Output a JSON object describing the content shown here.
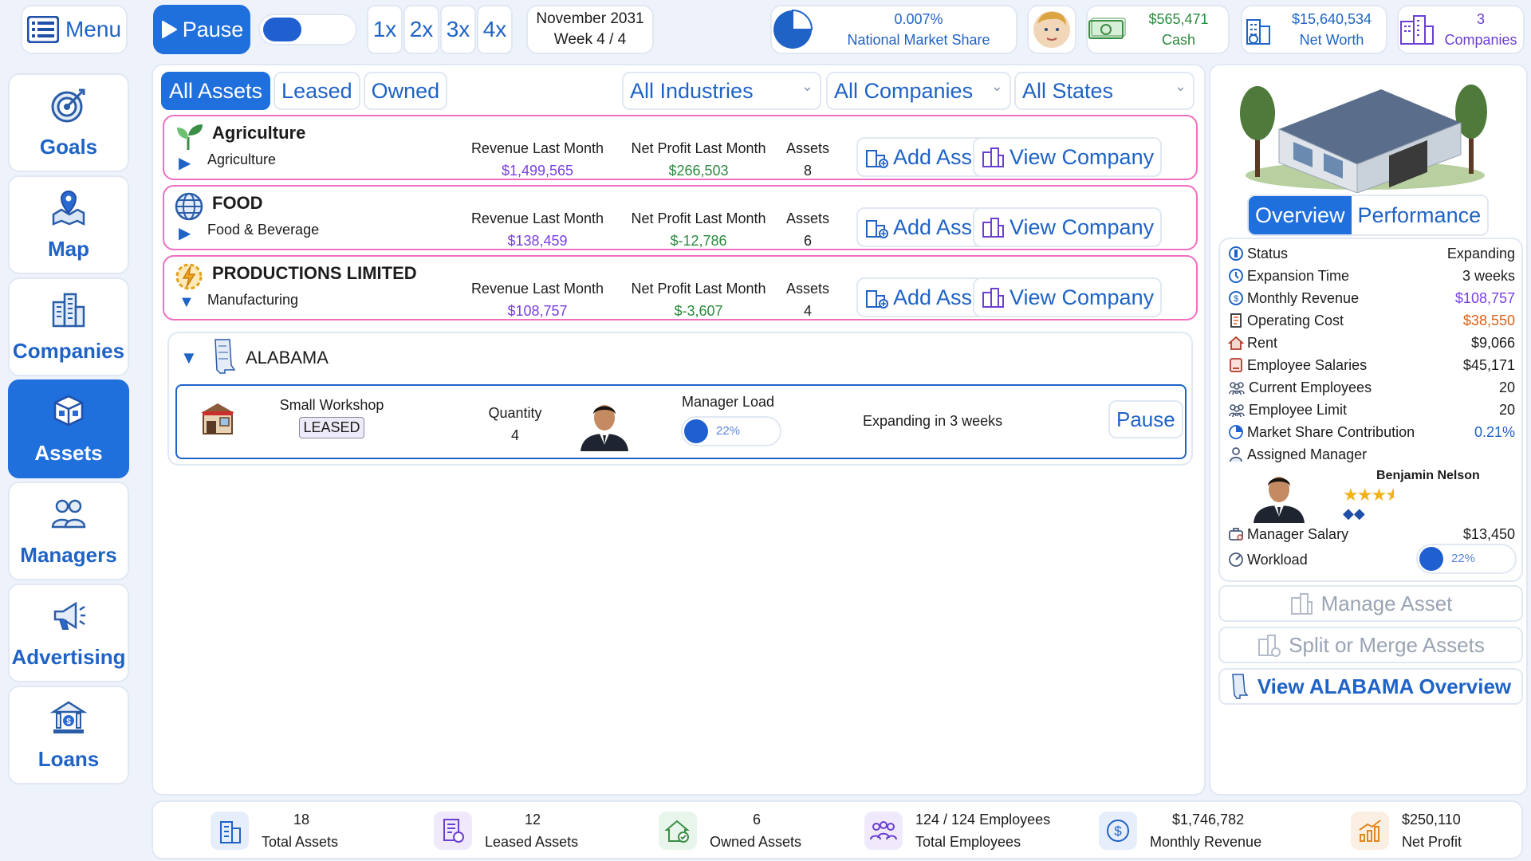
{
  "topbar": {
    "menu_label": "Menu",
    "pause_label": "Pause",
    "speeds": [
      "1x",
      "2x",
      "3x",
      "4x"
    ],
    "date": "November 2031",
    "week": "Week 4 / 4",
    "market_share": {
      "value": "0.007%",
      "label": "National Market Share"
    },
    "cash": {
      "value": "$565,471",
      "label": "Cash"
    },
    "net_worth": {
      "value": "$15,640,534",
      "label": "Net Worth"
    },
    "companies": {
      "value": "3",
      "label": "Companies"
    }
  },
  "sidebar": {
    "items": [
      {
        "label": "Goals",
        "icon": "target-icon"
      },
      {
        "label": "Map",
        "icon": "map-pin-icon"
      },
      {
        "label": "Companies",
        "icon": "buildings-icon"
      },
      {
        "label": "Assets",
        "icon": "boxes-icon",
        "active": true
      },
      {
        "label": "Managers",
        "icon": "people-icon"
      },
      {
        "label": "Advertising",
        "icon": "megaphone-icon"
      },
      {
        "label": "Loans",
        "icon": "bank-icon"
      }
    ]
  },
  "main": {
    "tabs": [
      "All Assets",
      "Leased",
      "Owned"
    ],
    "filters": {
      "industries": "All Industries",
      "companies": "All Companies",
      "states": "All States"
    },
    "col_labels": {
      "revenue": "Revenue Last Month",
      "profit": "Net Profit Last Month",
      "assets": "Assets"
    },
    "btn_labels": {
      "add": "Add Asset",
      "view": "View Company"
    },
    "companies": [
      {
        "name": "Agriculture",
        "industry": "Agriculture",
        "revenue": "$1,499,565",
        "profit": "$266,503",
        "assets": "8",
        "expanded": false
      },
      {
        "name": "FOOD",
        "industry": "Food & Beverage",
        "revenue": "$138,459",
        "profit": "$-12,786",
        "assets": "6",
        "expanded": false
      },
      {
        "name": "PRODUCTIONS LIMITED",
        "industry": "Manufacturing",
        "revenue": "$108,757",
        "profit": "$-3,607",
        "assets": "4",
        "expanded": true
      }
    ],
    "state": {
      "name": "ALABAMA",
      "asset": {
        "name": "Small Workshop",
        "badge": "LEASED",
        "quantity_label": "Quantity",
        "quantity": "4",
        "manager_load_label": "Manager Load",
        "manager_load": "22%",
        "manager_load_value": 0.22,
        "status": "Expanding in 3 weeks",
        "pause_label": "Pause"
      }
    }
  },
  "detail": {
    "tabs": [
      "Overview",
      "Performance"
    ],
    "rows": [
      {
        "label": "Status",
        "value": "Expanding",
        "color": "#1c1c1c"
      },
      {
        "label": "Expansion Time",
        "value": "3 weeks",
        "color": "#1c1c1c"
      },
      {
        "label": "Monthly Revenue",
        "value": "$108,757",
        "color": "#7a3fe4"
      },
      {
        "label": "Operating Cost",
        "value": "$38,550",
        "color": "#d9601c"
      },
      {
        "label": "Rent",
        "value": "$9,066",
        "color": "#1c1c1c"
      },
      {
        "label": "Employee Salaries",
        "value": "$45,171",
        "color": "#1c1c1c"
      },
      {
        "label": "Current Employees",
        "value": "20",
        "color": "#1c1c1c"
      },
      {
        "label": "Employee Limit",
        "value": "20",
        "color": "#1c1c1c"
      },
      {
        "label": "Market Share Contribution",
        "value": "0.21%",
        "color": "#1f63c6"
      },
      {
        "label": "Assigned Manager",
        "value": "",
        "color": "#1c1c1c"
      }
    ],
    "manager_name": "Benjamin Nelson",
    "manager_rating_stars": 3.5,
    "manager_gems": 2,
    "manager_salary_label": "Manager Salary",
    "manager_salary": "$13,450",
    "workload_label": "Workload",
    "workload": "22%",
    "workload_value": 0.22,
    "actions": {
      "manage": "Manage Asset",
      "split": "Split or Merge Assets",
      "view_state": "View ALABAMA Overview"
    }
  },
  "bottom": [
    {
      "value": "18",
      "label": "Total Assets",
      "icon": "building-icon",
      "bg": "#e6eefb"
    },
    {
      "value": "12",
      "label": "Leased Assets",
      "icon": "invoice-icon",
      "bg": "#efe9fb"
    },
    {
      "value": "6",
      "label": "Owned Assets",
      "icon": "house-check-icon",
      "bg": "#e8f5ea"
    },
    {
      "value": "124 / 124 Employees",
      "label": "Total Employees",
      "icon": "team-icon",
      "bg": "#efe9fb"
    },
    {
      "value": "$1,746,782",
      "label": "Monthly Revenue",
      "icon": "dollar-circle-icon",
      "bg": "#e6eefb"
    },
    {
      "value": "$250,110",
      "label": "Net Profit",
      "icon": "chart-up-icon",
      "bg": "#fbefe4"
    }
  ]
}
